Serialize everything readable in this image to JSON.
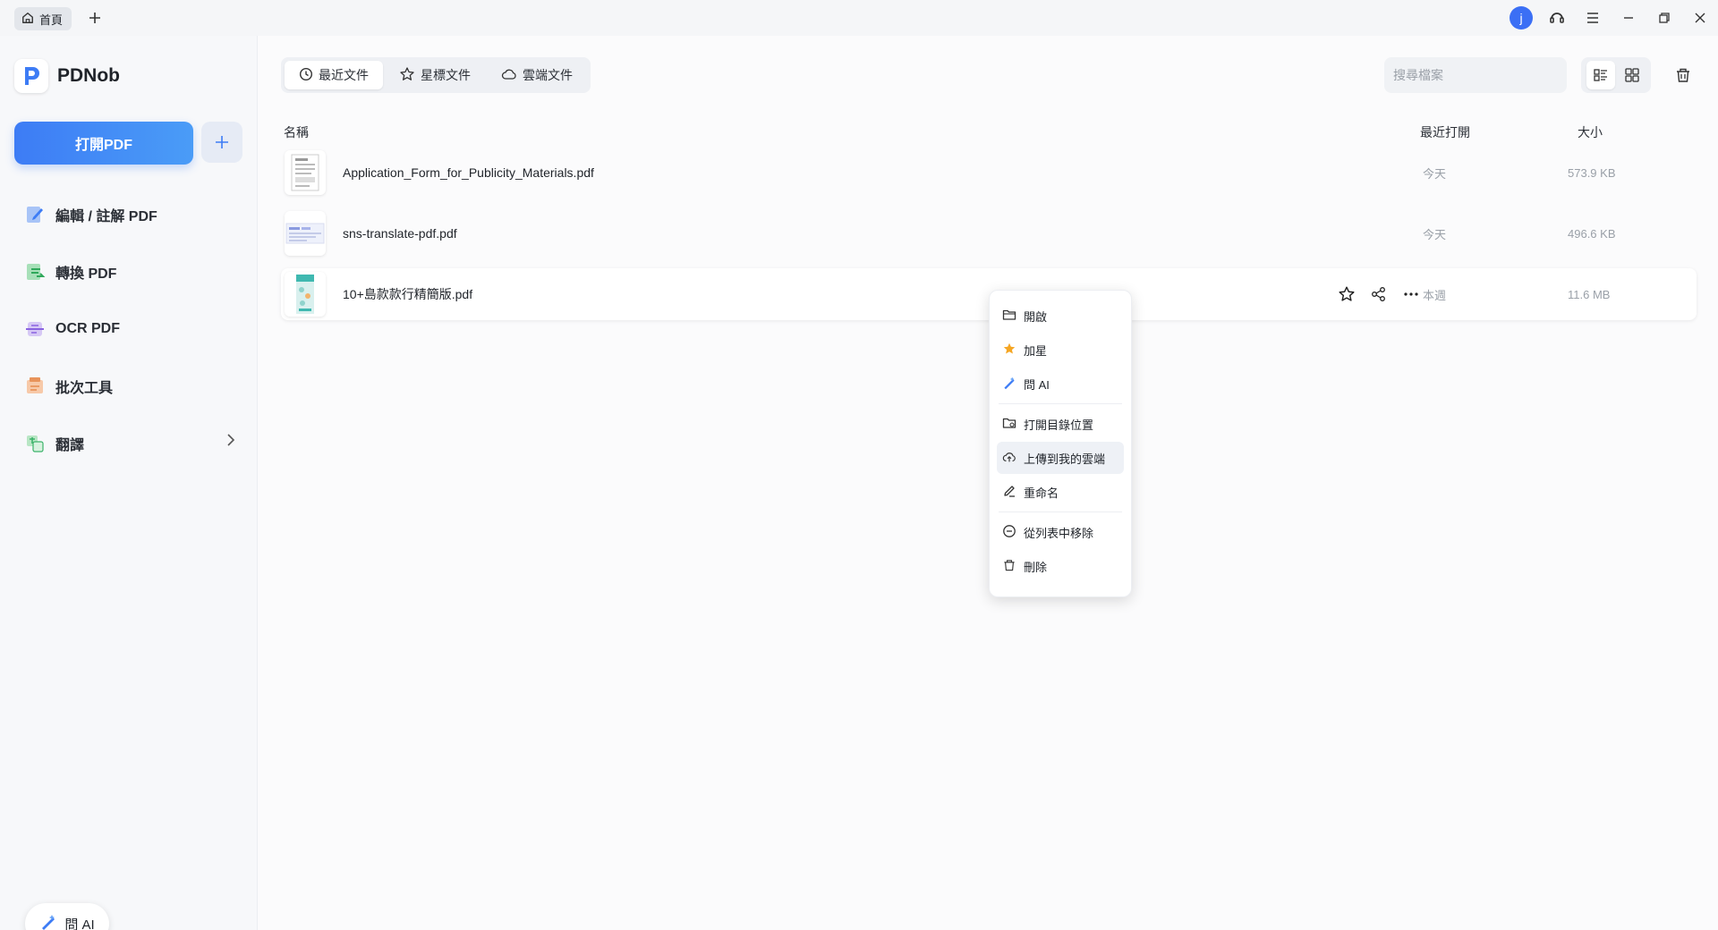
{
  "titlebar": {
    "home_tab": "首頁",
    "avatar_initial": "j"
  },
  "sidebar": {
    "logo": "PDNob",
    "open_pdf": "打開PDF",
    "nav": [
      {
        "label": "編輯 / 註解 PDF",
        "icon": "edit-pdf-icon"
      },
      {
        "label": "轉換 PDF",
        "icon": "convert-pdf-icon"
      },
      {
        "label": "OCR PDF",
        "icon": "ocr-pdf-icon"
      },
      {
        "label": "批次工具",
        "icon": "batch-tools-icon"
      },
      {
        "label": "翻譯",
        "icon": "translate-icon"
      }
    ],
    "ask_ai": "問 AI"
  },
  "main": {
    "tabs": [
      {
        "label": "最近文件",
        "icon": "clock-icon",
        "active": true
      },
      {
        "label": "星標文件",
        "icon": "star-icon",
        "active": false
      },
      {
        "label": "雲端文件",
        "icon": "cloud-icon",
        "active": false
      }
    ],
    "search_placeholder": "搜尋檔案",
    "columns": {
      "name": "名稱",
      "recent": "最近打開",
      "size": "大小"
    },
    "files": [
      {
        "name": "Application_Form_for_Publicity_Materials.pdf",
        "date": "今天",
        "size": "573.9 KB"
      },
      {
        "name": "sns-translate-pdf.pdf",
        "date": "今天",
        "size": "496.6 KB"
      },
      {
        "name": "10+島款款行精簡版.pdf",
        "date": "本週",
        "size": "11.6 MB"
      }
    ]
  },
  "context_menu": {
    "items": [
      {
        "label": "開啟",
        "icon": "folder-open-icon"
      },
      {
        "label": "加星",
        "icon": "star-filled-icon"
      },
      {
        "label": "問 AI",
        "icon": "ai-pen-icon"
      },
      {
        "label": "打開目錄位置",
        "icon": "folder-location-icon"
      },
      {
        "label": "上傳到我的雲端",
        "icon": "upload-cloud-icon"
      },
      {
        "label": "重命名",
        "icon": "rename-icon"
      },
      {
        "label": "從列表中移除",
        "icon": "remove-circle-icon"
      },
      {
        "label": "刪除",
        "icon": "trash-icon"
      }
    ]
  },
  "colors": {
    "accent": "#3d7cf5",
    "text_muted": "#9aa0a8",
    "star": "#f5a623"
  }
}
